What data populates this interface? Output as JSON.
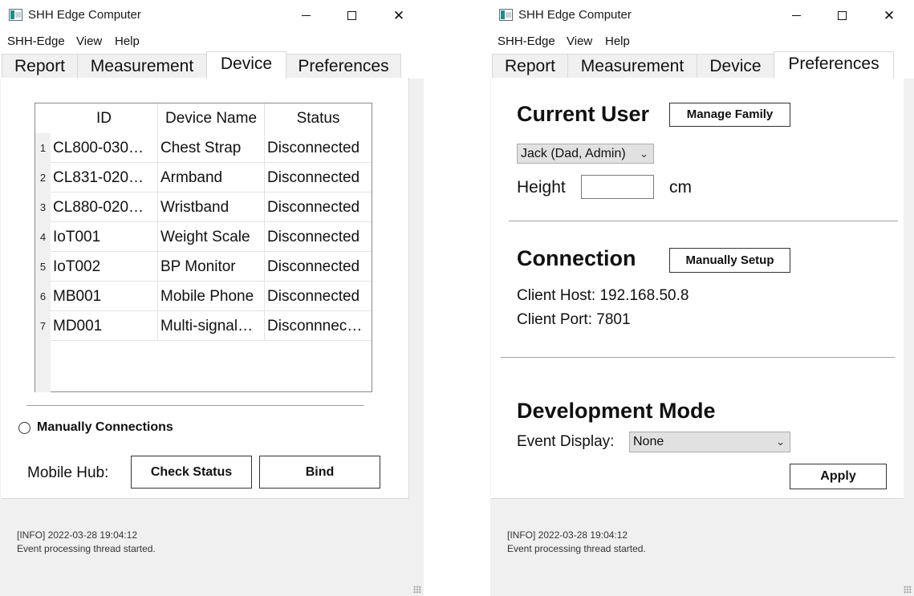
{
  "window": {
    "title": "SHH Edge Computer",
    "close_glyph": "✕"
  },
  "menu": [
    "SHH-Edge",
    "View",
    "Help"
  ],
  "tabs": [
    "Report",
    "Measurement",
    "Device",
    "Preferences"
  ],
  "device_tab": {
    "columns": [
      "ID",
      "Device Name",
      "Status"
    ],
    "rows": [
      {
        "num": "1",
        "id": "CL800-030…",
        "name": "Chest Strap",
        "status": "Disconnected"
      },
      {
        "num": "2",
        "id": "CL831-020…",
        "name": "Armband",
        "status": "Disconnected"
      },
      {
        "num": "3",
        "id": "CL880-020…",
        "name": "Wristband",
        "status": "Disconnected"
      },
      {
        "num": "4",
        "id": "IoT001",
        "name": "Weight Scale",
        "status": "Disconnected"
      },
      {
        "num": "5",
        "id": "IoT002",
        "name": "BP Monitor",
        "status": "Disconnected"
      },
      {
        "num": "6",
        "id": "MB001",
        "name": "Mobile Phone",
        "status": "Disconnected"
      },
      {
        "num": "7",
        "id": "MD001",
        "name": "Multi-signal…",
        "status": "Disconnnec…"
      }
    ],
    "manual_connections_label": "Manually Connections",
    "mobile_hub_label": "Mobile Hub:",
    "check_status_label": "Check Status",
    "bind_label": "Bind"
  },
  "preferences_tab": {
    "current_user_heading": "Current User",
    "manage_family_label": "Manage Family",
    "user_select_value": "Jack (Dad, Admin)",
    "height_label": "Height",
    "height_value": "",
    "height_unit": "cm",
    "connection_heading": "Connection",
    "manually_setup_label": "Manually Setup",
    "client_host": "Client Host: 192.168.50.8",
    "client_port": "Client Port: 7801",
    "development_heading": "Development Mode",
    "event_display_label": "Event Display:",
    "event_display_value": "None",
    "apply_label": "Apply"
  },
  "log": {
    "line1": "[INFO] 2022-03-28 19:04:12",
    "line2": "Event processing thread started."
  },
  "icons": {
    "app": "app-window-icon",
    "minimize": "minimize-icon",
    "maximize": "maximize-icon",
    "close": "close-icon",
    "dropdown": "chevron-down-icon",
    "resize": "resize-grip-icon"
  }
}
